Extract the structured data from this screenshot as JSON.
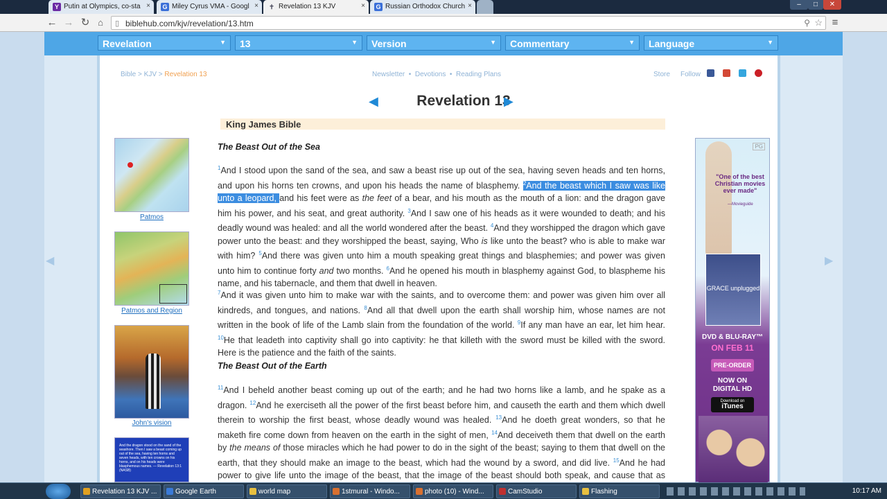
{
  "browser": {
    "tabs": [
      {
        "title": "Putin at Olympics, co-sta",
        "favicon": "Y",
        "color": "#6b2aa3"
      },
      {
        "title": "Miley Cyrus VMA - Googl",
        "favicon": "G",
        "color": "#3a6fd8"
      },
      {
        "title": "Revelation 13 KJV",
        "favicon": "✝",
        "color": "#9aa",
        "active": true
      },
      {
        "title": "Russian Orthodox Church",
        "favicon": "G",
        "color": "#3a6fd8"
      }
    ],
    "url": "biblehub.com/kjv/revelation/13.htm"
  },
  "selectors": [
    "Revelation",
    "13",
    "Version",
    "Commentary",
    "Language"
  ],
  "breadcrumb": {
    "bible": "Bible",
    "sep1": " > ",
    "kjv": "KJV",
    "sep2": " > ",
    "current": "Revelation 13"
  },
  "toplinks": {
    "newsletter": "Newsletter",
    "devotions": "Devotions",
    "reading_plans": "Reading Plans",
    "store": "Store",
    "follow": "Follow"
  },
  "chapter_title": "Revelation 13",
  "version_label": "King James Bible",
  "headings": [
    "The Beast Out of the Sea",
    "The Beast Out of the Earth"
  ],
  "p1": {
    "v1n": "1",
    "v1": "And I stood upon the sand of the sea, and saw a beast rise up out of the sea, having seven heads and ten horns, and upon his horns ten crowns, and upon his heads the name of blasphemy. ",
    "v2n": "2",
    "v2a": "And the beast which I saw was like unto a leopard, ",
    "v2b": "and his feet were as ",
    "v2i": "the feet",
    "v2c": " of a bear, and his mouth as the mouth of a lion: and the dragon gave him his power, and his seat, and great authority. ",
    "v3n": "3",
    "v3": "And I saw one of his heads as it were wounded to death; and his deadly wound was healed: and all the world wondered after the beast. ",
    "v4n": "4",
    "v4a": "And they worshipped the dragon which gave power unto the beast: and they worshipped the beast, saying, Who ",
    "v4i": "is",
    "v4b": " like unto the beast? who is able to make war with him? ",
    "v5n": "5",
    "v5": "And there was given unto him a mouth speaking great things and blasphemies; and power was given unto him to continue forty ",
    "v5i": "and",
    "v5b": " two months. ",
    "v6n": "6",
    "v6": "And he opened his mouth in blasphemy against God, to blaspheme his name, and his tabernacle, and them that dwell in heaven."
  },
  "p2": {
    "v7n": "7",
    "v7": "And it was given unto him to make war with the saints, and to overcome them: and power was given him over all kindreds, and tongues, and nations. ",
    "v8n": "8",
    "v8": "And all that dwell upon the earth shall worship him, whose names are not written in the book of life of the Lamb slain from the foundation of the world. ",
    "v9n": "9",
    "v9": "If any man have an ear, let him hear. ",
    "v10n": "10",
    "v10": "He that leadeth into captivity shall go into captivity: he that killeth with the sword must be killed with the sword. Here is the patience and the faith of the saints."
  },
  "p3": {
    "v11n": "11",
    "v11": "And I beheld another beast coming up out of the earth; and he had two horns like a lamb, and he spake as a dragon. ",
    "v12n": "12",
    "v12": "And he exerciseth all the power of the first beast before him, and causeth the earth and them which dwell therein to worship the first beast, whose deadly wound was healed. ",
    "v13n": "13",
    "v13": "And he doeth great wonders, so that he maketh fire come down from heaven on the earth in the sight of men, ",
    "v14n": "14",
    "v14a": "And deceiveth them that dwell on the earth by ",
    "v14i": "the means of",
    "v14b": " those miracles which he had power to do in the sight of the beast; saying to them that dwell on the earth, that they should make an image to the beast, which had the wound by a sword, and did live. ",
    "v15n": "15",
    "v15": "And he had power to give life unto the image of the beast, that the image of the beast should both speak, and cause that as many as would not worship the image of the beast should be killed."
  },
  "sidebar": [
    {
      "caption": "Patmos",
      "kind": "map"
    },
    {
      "caption": "Patmos and Region",
      "kind": "map"
    },
    {
      "caption": "John's vision",
      "kind": "painting"
    }
  ],
  "sidebar_card_text": "And the dragon stood on the sand of the seashore. Then I saw a beast coming up out of the sea, having ten horns and seven heads, with ten crowns on his horns, and on his heads were blasphemous names. — Revelation 13:1 (NASB)",
  "ad": {
    "badge": "PG",
    "quote": "\"One of the best Christian movies ever made\"",
    "quote_src": "—Movieguide",
    "cover": "GRACE unplugged",
    "release": "DVD & BLU-RAY™",
    "date": "ON FEB 11",
    "preorder": "PRE-ORDER",
    "now": "NOW ON DIGITAL HD",
    "itunes_small": "Download on",
    "itunes": "iTunes"
  },
  "taskbar": {
    "items": [
      {
        "label": "Revelation 13 KJV ...",
        "color": "#e0a020"
      },
      {
        "label": "Google Earth",
        "color": "#3a7ad8"
      },
      {
        "label": "world map",
        "color": "#e8c040"
      },
      {
        "label": "1stmural - Windo...",
        "color": "#d87030"
      },
      {
        "label": "photo (10) - Wind...",
        "color": "#d87030"
      },
      {
        "label": "CamStudio",
        "color": "#c03030"
      },
      {
        "label": "Flashing",
        "color": "#e8c040"
      }
    ],
    "clock": "10:17 AM"
  }
}
